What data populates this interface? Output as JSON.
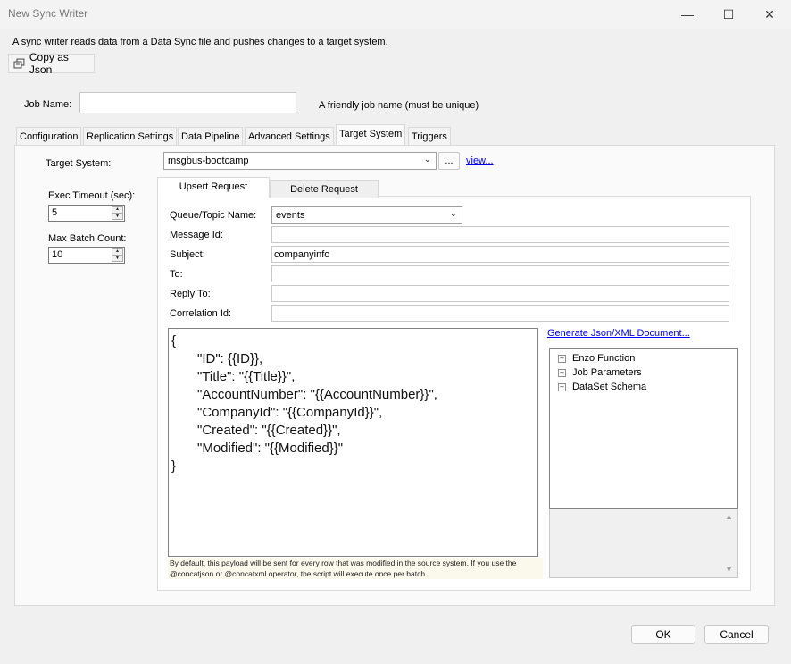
{
  "window": {
    "title": "New Sync Writer",
    "controls": {
      "minimize": "—",
      "maximize": "☐",
      "close": "✕"
    }
  },
  "description": "A sync writer reads data from a Data Sync file and pushes changes to a target system.",
  "toolbar": {
    "copy_json_label": "Copy as Json",
    "copy_icon": "copy-icon"
  },
  "job": {
    "name_label": "Job Name:",
    "name_value": "",
    "hint": "A friendly job name (must be unique)"
  },
  "tabs": [
    {
      "label": "Configuration"
    },
    {
      "label": "Replication Settings"
    },
    {
      "label": "Data Pipeline"
    },
    {
      "label": "Advanced Settings"
    },
    {
      "label": "Target System",
      "active": true
    },
    {
      "label": "Triggers"
    }
  ],
  "target": {
    "label": "Target System:",
    "value": "msgbus-bootcamp",
    "browse_label": "...",
    "view_link": "view..."
  },
  "exec_timeout": {
    "label": "Exec Timeout (sec):",
    "value": "5"
  },
  "max_batch": {
    "label": "Max Batch Count:",
    "value": "10"
  },
  "subtabs": [
    {
      "label": "Upsert Request",
      "active": true
    },
    {
      "label": "Delete Request"
    }
  ],
  "form": {
    "queue_label": "Queue/Topic Name:",
    "queue_value": "events",
    "message_id_label": "Message Id:",
    "message_id_value": "",
    "subject_label": "Subject:",
    "subject_value": "companyinfo",
    "to_label": "To:",
    "to_value": "",
    "reply_to_label": "Reply To:",
    "reply_to_value": "",
    "correlation_label": "Correlation Id:",
    "correlation_value": ""
  },
  "editor": {
    "lines": [
      "{",
      "\"ID\": {{ID}},",
      "\"Title\": \"{{Title}}\",",
      "\"AccountNumber\": \"{{AccountNumber}}\",",
      "\"CompanyId\": \"{{CompanyId}}\",",
      "\"Created\": \"{{Created}}\",",
      "\"Modified\": \"{{Modified}}\"",
      "}"
    ]
  },
  "note": "By default, this payload will be sent for every row that was modified in the source system.  If you use the @concatjson or @concatxml operator, the script will execute once per batch.",
  "generate_link": "Generate Json/XML Document...",
  "tree": {
    "items": [
      {
        "label": "Enzo Function"
      },
      {
        "label": "Job Parameters"
      },
      {
        "label": "DataSet Schema"
      }
    ]
  },
  "buttons": {
    "ok": "OK",
    "cancel": "Cancel"
  }
}
